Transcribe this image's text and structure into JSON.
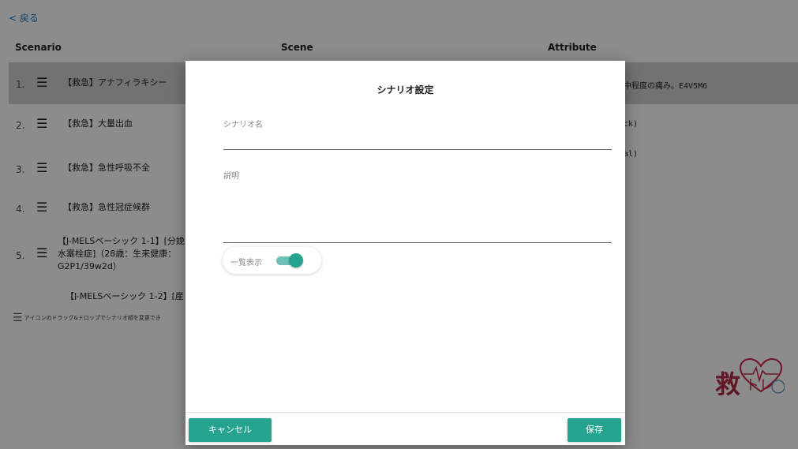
{
  "nav": {
    "back_label": "< 戻る"
  },
  "table": {
    "headers": {
      "scenario": "Scenario",
      "scene": "Scene",
      "attribute": "Attribute"
    },
    "rows": [
      {
        "num": "1.",
        "name": "【救急】アナフィラキシー",
        "attribute": "中程度の痛み。E4V5M6",
        "selected": true
      },
      {
        "num": "2.",
        "name": "【救急】大量出血",
        "attribute": "ck)"
      },
      {
        "num": "3.",
        "name": "【救急】急性呼吸不全",
        "attribute": "al)"
      },
      {
        "num": "4.",
        "name": "【救急】急性冠症候群",
        "attribute": ""
      },
      {
        "num": "5.",
        "name": "【J-MELSベーシック 1-1】[分娩 羊水塞栓症]（28歳：生来健康：G2P1/39w2d）",
        "attribute": ""
      },
      {
        "num": "",
        "name": "【J-MELSベーシック 1-2】[産",
        "attribute": ""
      }
    ]
  },
  "hint": {
    "text": "アイコンのドラッグ&ドロップでシナリオ順を変更でき"
  },
  "logo": {
    "kyu": "救",
    "tore": "トレ"
  },
  "dialog": {
    "title": "シナリオ設定",
    "scenario_name_label": "シナリオ名",
    "scenario_name_value": "",
    "description_label": "説明",
    "description_value": "",
    "list_display_label": "一覧表示",
    "list_display_on": true,
    "cancel_label": "キャンセル",
    "save_label": "保存"
  },
  "colors": {
    "accent": "#26a38f",
    "link": "#1a73c8",
    "brand": "#b22a45"
  }
}
